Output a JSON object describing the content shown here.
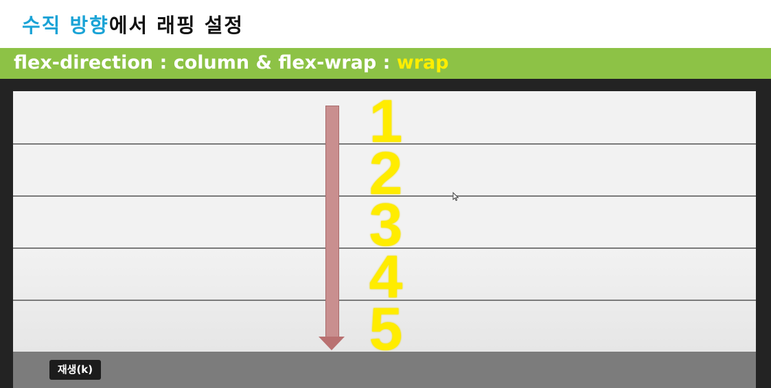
{
  "slide": {
    "title_highlight": "수직 방향",
    "title_rest": "에서 래핑 설정",
    "subtitle_white": "flex-direction : column & flex-wrap : ",
    "subtitle_yellow": "wrap",
    "numbers": [
      "1",
      "2",
      "3",
      "4",
      "5"
    ]
  },
  "player": {
    "tooltip": "재생(k)"
  },
  "colors": {
    "title_highlight": "#1aa3d6",
    "banner_green": "#8dc246",
    "number_yellow": "#ffec00",
    "arrow": "#c98f8f"
  },
  "icons": {
    "direction_arrow": "arrow-down-icon",
    "mouse_cursor": "cursor-icon"
  }
}
